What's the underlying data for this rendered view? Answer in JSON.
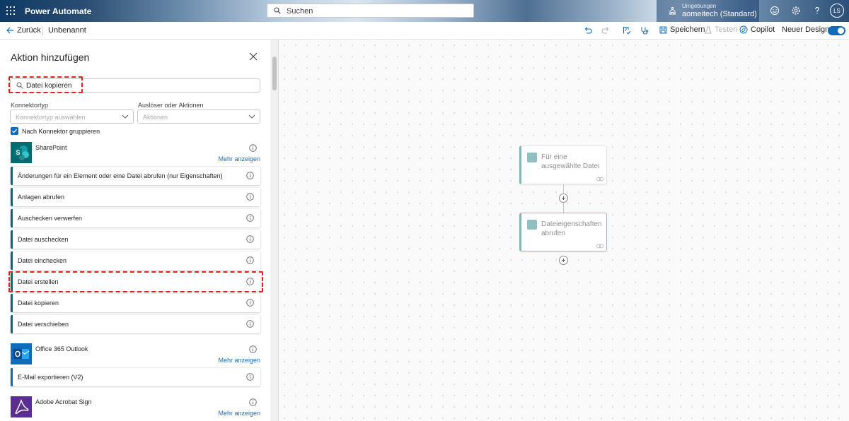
{
  "header": {
    "app_name": "Power Automate",
    "search_placeholder": "Suchen",
    "environment_label": "Umgebungen",
    "environment_name": "aomeitech (Standard)",
    "avatar_initials": "LS"
  },
  "commandbar": {
    "back_label": "Zurück",
    "flow_name": "Unbenannt",
    "save_label": "Speichern",
    "test_label": "Testen",
    "copilot_label": "Copilot",
    "new_designer_label": "Neuer Designer",
    "new_designer_on": true
  },
  "panel": {
    "title": "Aktion hinzufügen",
    "search_value": "Datei kopieren",
    "connector_type_label": "Konnektortyp",
    "connector_type_placeholder": "Konnektortyp auswählen",
    "trigger_action_label": "Auslöser oder Aktionen",
    "trigger_action_placeholder": "Aktionen",
    "group_by_connector_label": "Nach Konnektor gruppieren",
    "group_by_connector_checked": true,
    "connectors": [
      {
        "name": "SharePoint",
        "more_label": "Mehr anzeigen",
        "color": "#036c70",
        "actions": [
          "Änderungen für ein Element oder eine Datei abrufen (nur Eigenschaften)",
          "Anlagen abrufen",
          "Auschecken verwerfen",
          "Datei auschecken",
          "Datei einchecken",
          "Datei erstellen",
          "Datei kopieren",
          "Datei verschieben"
        ]
      },
      {
        "name": "Office 365 Outlook",
        "more_label": "Mehr anzeigen",
        "color": "#0f6cbd",
        "actions": [
          "E-Mail exportieren (V2)"
        ]
      },
      {
        "name": "Adobe Acrobat Sign",
        "more_label": "Mehr anzeigen",
        "color": "#5c2d91",
        "actions": []
      }
    ]
  },
  "canvas": {
    "nodes": [
      {
        "title": "Für eine ausgewählte Datei"
      },
      {
        "title": "Dateieigenschaften abrufen"
      }
    ]
  }
}
